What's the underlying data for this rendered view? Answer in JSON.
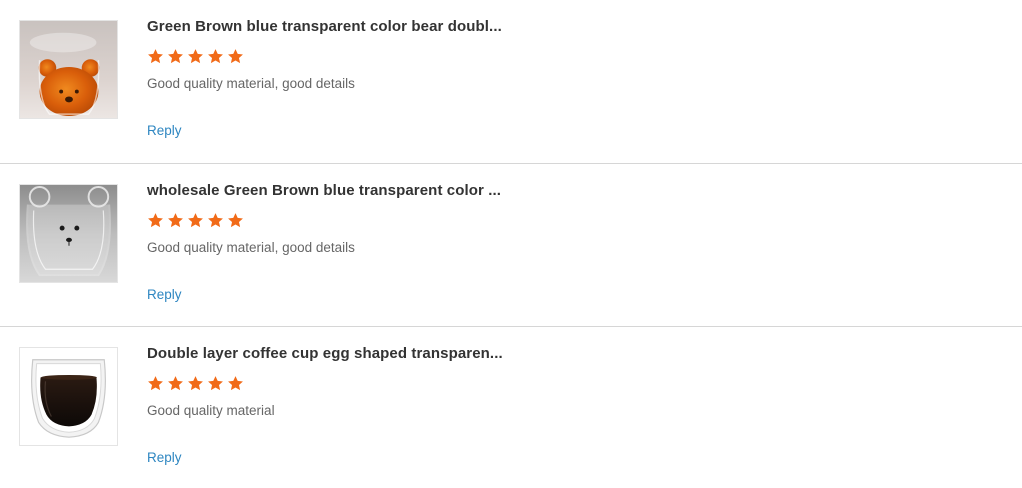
{
  "reviews": [
    {
      "title": "Green Brown blue transparent color bear doubl...",
      "rating": 5,
      "rating_color": "#f16a18",
      "comment": "Good quality material, good details",
      "reply_label": "Reply",
      "thumbnail_icon": "amber-bear-glass-cup-image"
    },
    {
      "title": "wholesale Green Brown blue transparent color ...",
      "rating": 5,
      "rating_color": "#f16a18",
      "comment": "Good quality material, good details",
      "reply_label": "Reply",
      "thumbnail_icon": "clear-bear-glass-cup-image"
    },
    {
      "title": "Double layer coffee cup egg shaped transparen...",
      "rating": 5,
      "rating_color": "#f16a18",
      "comment": "Good quality material",
      "reply_label": "Reply",
      "thumbnail_icon": "double-wall-coffee-cup-image"
    }
  ]
}
